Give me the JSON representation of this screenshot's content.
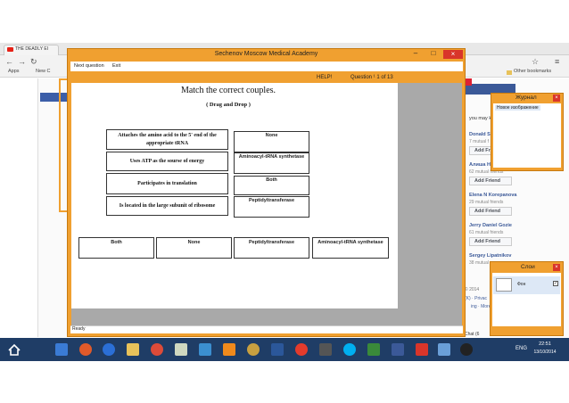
{
  "browser": {
    "tab_label": "THE DEADLY EI",
    "apps_label": "Apps",
    "newtab_label": "New C",
    "other_bookmarks": "Other bookmarks"
  },
  "facebook": {
    "people_you_may_know": "you may k",
    "people": [
      {
        "name": "Donald S",
        "friends": "7 mutual f"
      },
      {
        "name": "Алиша Н",
        "friends": "62 mutual friends"
      },
      {
        "name": "Elena N Korepanova",
        "friends": "29 mutual friends"
      },
      {
        "name": "Jerry Daniel Gozie",
        "friends": "61 mutual friends"
      },
      {
        "name": "Sergey Lipatnikov",
        "friends": "38 mutual"
      }
    ],
    "add_friend_label": "Add Friend",
    "copyright": "© 2014",
    "privacy": "(K) · Privac",
    "more": "ing · More ·",
    "chat": "Chat (6"
  },
  "journal": {
    "title": "Журнал",
    "item": "Новое изображение"
  },
  "layers": {
    "title": "Слои",
    "layer_name": "Фон"
  },
  "quiz": {
    "window_title": "Sechenov Moscow Medical Academy",
    "menu_next": "Next question",
    "menu_exit": "Exit",
    "help": "HELP!",
    "question_label": "Question ¹ 1 of 13",
    "heading": "Match the correct couples.",
    "subheading": "( Drag and Drop )",
    "status": "Ready",
    "questions": [
      "Attaches the amino acid to the 5' end of the appropriate tRNA",
      "Uses ATP as the sourse of energy",
      "Participates in translation",
      "Is located in the large subunit of ribosome"
    ],
    "answer_slots": [
      "None",
      "Aminoacyl-tRNA synthetase",
      "Both",
      "Peptidyltransferase"
    ],
    "options": [
      "Both",
      "None",
      "Peptidyltransferase",
      "Aminoacyl-tRNA synthetase"
    ]
  },
  "taskbar": {
    "language": "ENG",
    "time": "22:51",
    "date": "13/10/2014"
  },
  "colors": {
    "window_frame": "#f0a030",
    "taskbar": "#1f3d66",
    "close_red": "#d9352a"
  }
}
